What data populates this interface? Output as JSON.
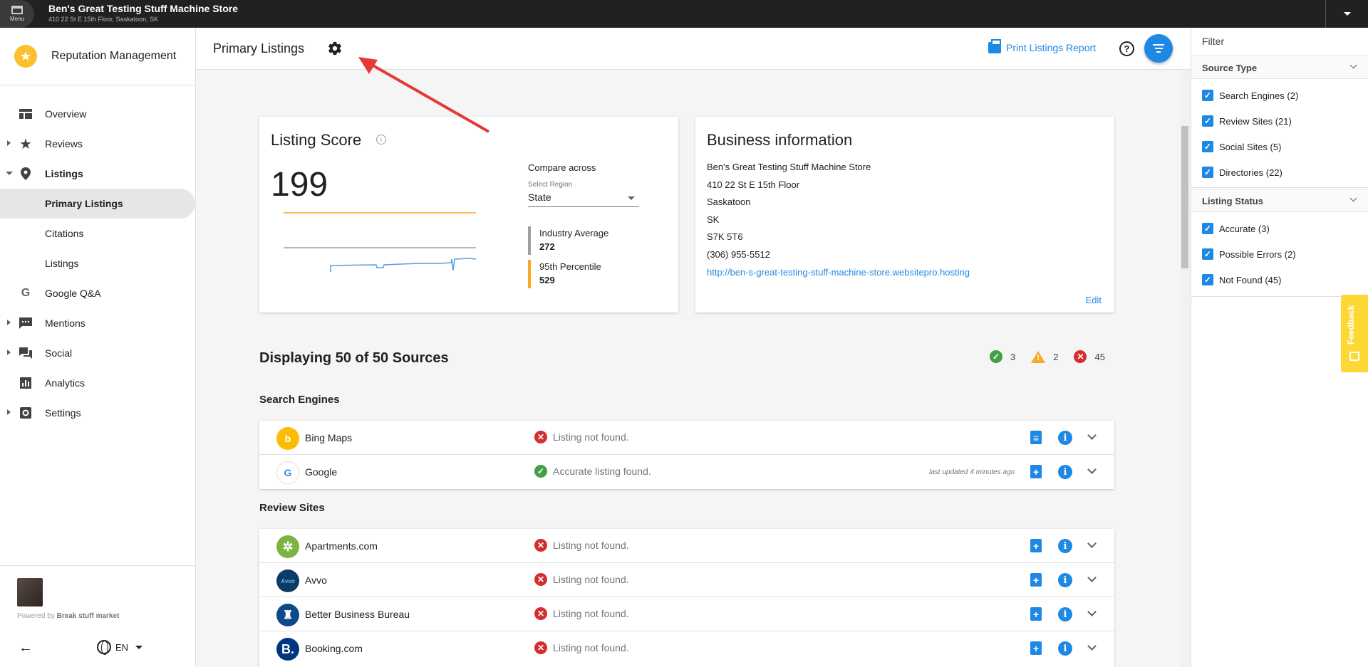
{
  "topbar": {
    "menu_label": "Menu",
    "business_name": "Ben's Great Testing Stuff Machine Store",
    "business_address": "410 22 St E 15th Floor, Saskatoon, SK"
  },
  "sidebar": {
    "app_title": "Reputation Management",
    "items": [
      {
        "label": "Overview",
        "icon": "dashboard-icon"
      },
      {
        "label": "Reviews",
        "icon": "star-icon"
      },
      {
        "label": "Listings",
        "icon": "location-pin-icon"
      },
      {
        "label": "Primary Listings"
      },
      {
        "label": "Citations"
      },
      {
        "label": "Listings"
      },
      {
        "label": "Google Q&A",
        "icon": "google-icon"
      },
      {
        "label": "Mentions",
        "icon": "chat-bubble-icon"
      },
      {
        "label": "Social",
        "icon": "forum-icon"
      },
      {
        "label": "Analytics",
        "icon": "bar-chart-icon"
      },
      {
        "label": "Settings",
        "icon": "settings-icon"
      }
    ],
    "powered_by_prefix": "Powered by",
    "powered_by_name": "Break stuff market",
    "language": "EN"
  },
  "header": {
    "title": "Primary Listings",
    "print_label": "Print Listings Report",
    "help_glyph": "?"
  },
  "score_card": {
    "title": "Listing Score",
    "score": "199",
    "compare_label": "Compare across",
    "region_label": "Select Region",
    "region_value": "State",
    "industry_label": "Industry Average",
    "industry_value": "272",
    "percentile_label": "95th Percentile",
    "percentile_value": "529",
    "colors": {
      "score_line": "#5c9ce6",
      "industry_line": "#9e9e9e",
      "percentile_line": "#f9a825"
    }
  },
  "business_card": {
    "title": "Business information",
    "name": "Ben's Great Testing Stuff Machine Store",
    "street": "410 22 St E 15th Floor",
    "city": "Saskatoon",
    "province": "SK",
    "postal": "S7K 5T6",
    "phone": "(306) 955-5512",
    "website": "http://ben-s-great-testing-stuff-machine-store.websitepro.hosting",
    "edit_label": "Edit"
  },
  "sources": {
    "heading": "Displaying 50 of 50 Sources",
    "accurate_count": "3",
    "possible_errors_count": "2",
    "not_found_count": "45"
  },
  "search_engines": {
    "title": "Search Engines",
    "rows": [
      {
        "name": "Bing Maps",
        "status": "Listing not found.",
        "state": "not_found",
        "logo_color": "#fbbc05",
        "logo_glyph": "b"
      },
      {
        "name": "Google",
        "status": "Accurate listing found.",
        "state": "accurate",
        "logo_color": "#ffffff",
        "logo_glyph": "G",
        "last_updated": "last updated 4 minutes ago"
      }
    ]
  },
  "review_sites": {
    "title": "Review Sites",
    "rows": [
      {
        "name": "Apartments.com",
        "status": "Listing not found.",
        "state": "not_found",
        "logo_color": "#7cb342",
        "logo_glyph": "✲"
      },
      {
        "name": "Avvo",
        "status": "Listing not found.",
        "state": "not_found",
        "logo_color": "#0d3b66",
        "logo_glyph": "Avvo"
      },
      {
        "name": "Better Business Bureau",
        "status": "Listing not found.",
        "state": "not_found",
        "logo_color": "#0d4a8a",
        "logo_glyph": "♜"
      },
      {
        "name": "Booking.com",
        "status": "Listing not found.",
        "state": "not_found",
        "logo_color": "#003580",
        "logo_glyph": "B."
      }
    ]
  },
  "filter_panel": {
    "title": "Filter",
    "source_type": {
      "title": "Source Type",
      "options": [
        "Search Engines (2)",
        "Review Sites (21)",
        "Social Sites (5)",
        "Directories (22)"
      ]
    },
    "listing_status": {
      "title": "Listing Status",
      "options": [
        "Accurate (3)",
        "Possible Errors (2)",
        "Not Found (45)"
      ]
    },
    "feedback_label": "Feedback"
  }
}
